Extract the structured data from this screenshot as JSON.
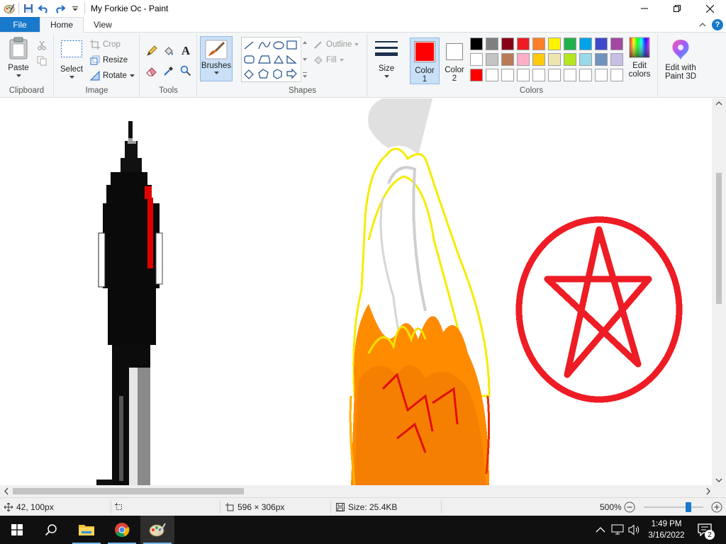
{
  "window": {
    "title": "My Forkie Oc - Paint"
  },
  "tabs": {
    "file": "File",
    "home": "Home",
    "view": "View"
  },
  "ribbon": {
    "clipboard": {
      "paste": "Paste",
      "label": "Clipboard"
    },
    "image": {
      "select": "Select",
      "crop": "Crop",
      "resize": "Resize",
      "rotate": "Rotate",
      "label": "Image"
    },
    "tools": {
      "label": "Tools"
    },
    "brushes": {
      "label": "Brushes"
    },
    "shapes": {
      "outline": "Outline",
      "fill": "Fill",
      "label": "Shapes"
    },
    "size": {
      "label": "Size"
    },
    "colors": {
      "color1_label": "Color",
      "color1_num": "1",
      "color2_label": "Color",
      "color2_num": "2",
      "edit_colors_line1": "Edit",
      "edit_colors_line2": "colors",
      "paint3d_line1": "Edit with",
      "paint3d_line2": "Paint 3D",
      "label": "Colors",
      "color1": "#ff0000",
      "color2": "#ffffff",
      "palette_row1": [
        "#000000",
        "#7f7f7f",
        "#880015",
        "#ed1c24",
        "#ff7f27",
        "#fff200",
        "#22b14c",
        "#00a2e8",
        "#3f48cc",
        "#a349a4"
      ],
      "palette_row2": [
        "#ffffff",
        "#c3c3c3",
        "#b97a57",
        "#ffaec9",
        "#ffc90e",
        "#efe4b0",
        "#b5e61d",
        "#99d9ea",
        "#7092be",
        "#c8bfe7"
      ],
      "palette_row3": [
        "#ff0000",
        "#ffffff",
        "#ffffff",
        "#ffffff",
        "#ffffff",
        "#ffffff",
        "#ffffff",
        "#ffffff",
        "#ffffff",
        "#ffffff"
      ]
    }
  },
  "status": {
    "cursor_pos": "42, 100px",
    "image_size": "596 × 306px",
    "file_size": "Size: 25.4KB",
    "zoom": "500%",
    "zoom_level_fraction": 0.77
  },
  "taskbar": {
    "time": "1:49 PM",
    "date": "3/16/2022",
    "notifications": "2"
  }
}
